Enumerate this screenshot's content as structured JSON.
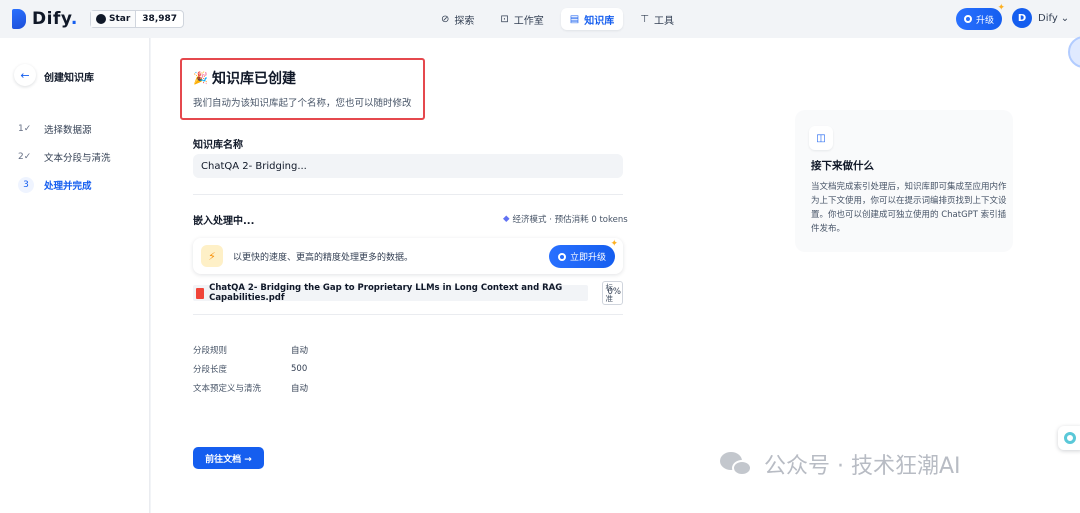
{
  "header": {
    "brand": "Dify",
    "brand_suffix": ".",
    "github_star_label": "Star",
    "github_star_count": "38,987",
    "nav": [
      {
        "icon": "compass-icon",
        "glyph": "⊘",
        "label": "探索"
      },
      {
        "icon": "robot-icon",
        "glyph": "⊡",
        "label": "工作室"
      },
      {
        "icon": "book-icon",
        "glyph": "▤",
        "label": "知识库",
        "active": true
      },
      {
        "icon": "tool-icon",
        "glyph": "⊤",
        "label": "工具"
      }
    ],
    "upgrade_label": "升级",
    "user_initial": "D",
    "user_name": "Dify",
    "user_chevron": "⌄"
  },
  "sidebar": {
    "back_glyph": "←",
    "title": "创建知识库",
    "steps": [
      {
        "indicator": "1✓",
        "label": "选择数据源"
      },
      {
        "indicator": "2✓",
        "label": "文本分段与清洗"
      },
      {
        "indicator": "3",
        "label": "处理并完成",
        "active": true
      }
    ]
  },
  "main": {
    "created_icon": "🎉",
    "created_title": "知识库已创建",
    "created_subtitle": "我们自动为该知识库起了个名称，您也可以随时修改",
    "kb_name_label": "知识库名称",
    "kb_name_value": "ChatQA 2- Bridging...",
    "embedding_title": "嵌入处理中...",
    "embedding_meta": "经济模式 · 预估消耗 0 tokens",
    "promo_text": "以更快的速度、更高的精度处理更多的数据。",
    "promo_button": "立即升级",
    "file": {
      "name": "ChatQA 2- Bridging the Gap to Proprietary LLMs in Long Context and RAG Capabilities.pdf",
      "tag": "标准",
      "progress": "0%"
    },
    "params": [
      {
        "key": "分段规则",
        "value": "自动"
      },
      {
        "key": "分段长度",
        "value": "500"
      },
      {
        "key": "文本预定义与清洗",
        "value": "自动"
      }
    ],
    "goto_button": "前往文档 →"
  },
  "tip": {
    "icon_glyph": "◫",
    "title": "接下来做什么",
    "body": "当文档完成索引处理后，知识库即可集成至应用内作为上下文使用，你可以在提示词编排页找到上下文设置。你也可以创建成可独立使用的 ChatGPT 索引插件发布。"
  },
  "watermark": "公众号 · 技术狂潮AI",
  "colors": {
    "accent": "#155eef",
    "highlight_border": "#e5484d",
    "pdf_red": "#f04438"
  }
}
